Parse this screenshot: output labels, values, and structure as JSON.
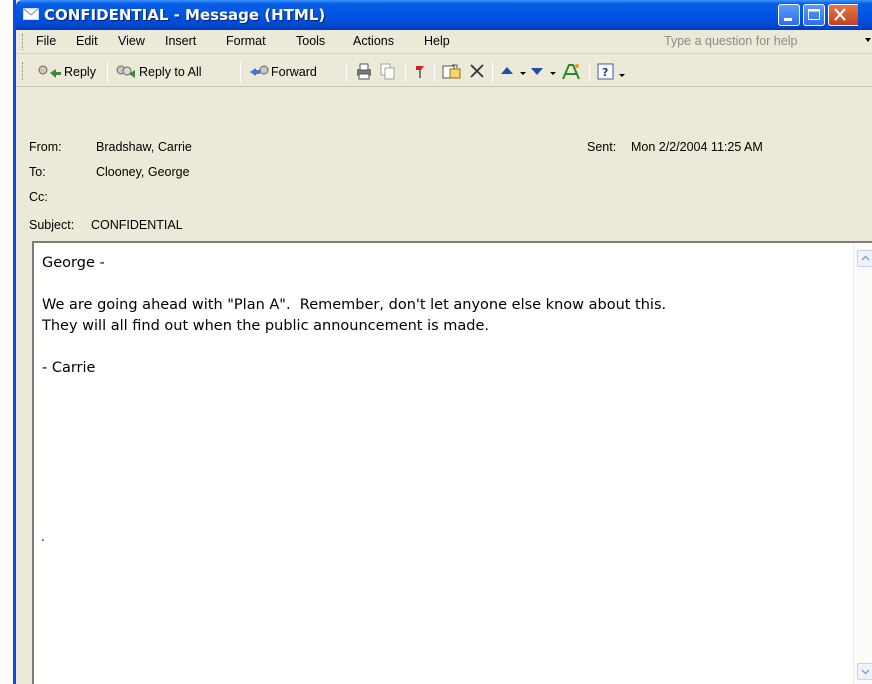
{
  "window": {
    "title": "CONFIDENTIAL - Message (HTML)"
  },
  "menu": {
    "items": [
      "File",
      "Edit",
      "View",
      "Insert",
      "Format",
      "Tools",
      "Actions",
      "Help"
    ],
    "help_placeholder": "Type a question for help"
  },
  "toolbar": {
    "reply": "Reply",
    "reply_all": "Reply to All",
    "forward": "Forward",
    "icons": [
      "print-icon",
      "copy-icon",
      "flag-icon",
      "move-to-folder-icon",
      "delete-icon",
      "previous-item-icon",
      "next-item-icon",
      "address-book-icon",
      "help-icon"
    ]
  },
  "headers": {
    "from_label": "From:",
    "from_value": "Bradshaw, Carrie",
    "to_label": "To:",
    "to_value": "Clooney, George",
    "cc_label": "Cc:",
    "cc_value": "",
    "subject_label": "Subject:",
    "subject_value": "CONFIDENTIAL",
    "sent_label": "Sent:",
    "sent_value": "Mon 2/2/2004 11:25 AM"
  },
  "message": {
    "body": "George -\n\nWe are going ahead with \"Plan A\".  Remember, don't let anyone else know about this.\nThey will all find out when the public announcement is made.\n\n- Carrie",
    "trailing_mark": "."
  },
  "colors": {
    "titlebar": "#0054e3",
    "window_bg": "#ece9d8",
    "close_button": "#c4411c"
  }
}
